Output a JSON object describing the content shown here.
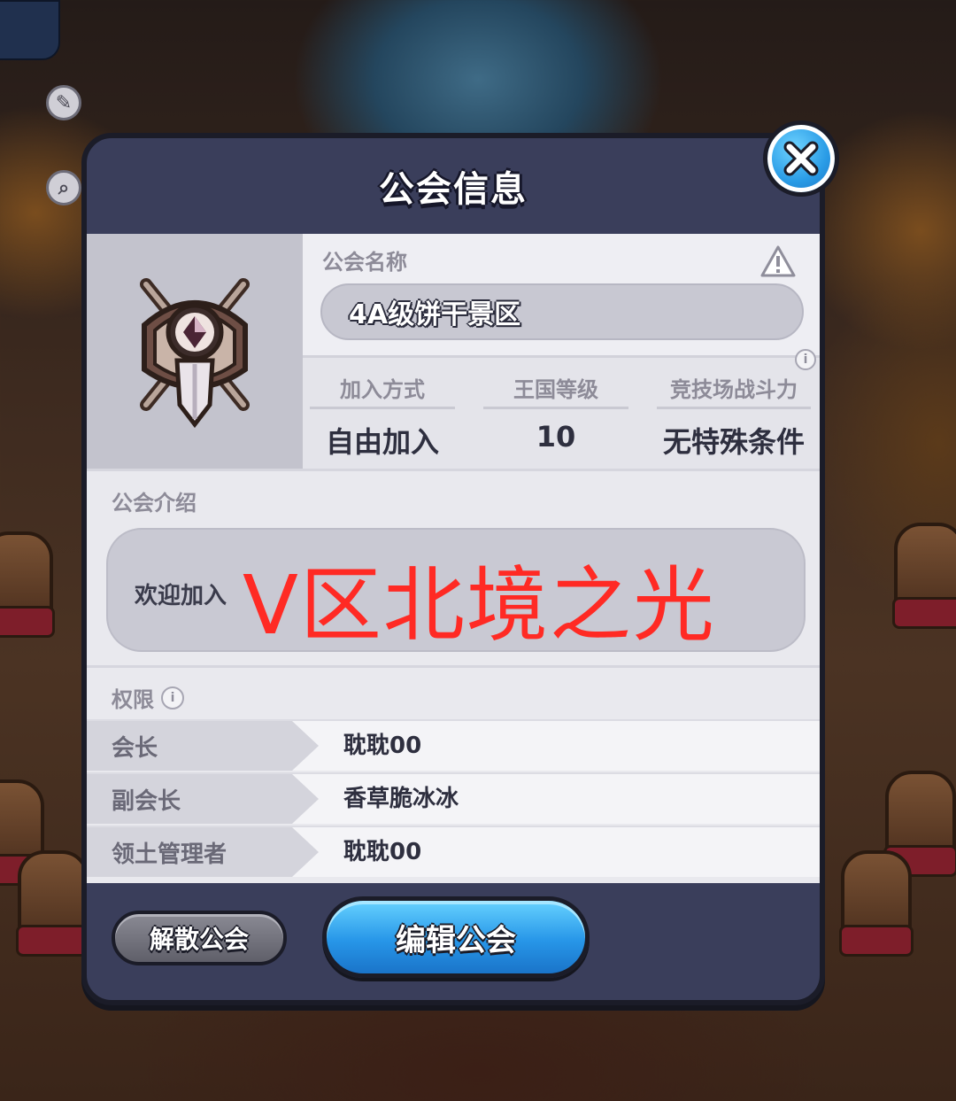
{
  "dialog": {
    "title": "公会信息",
    "close_icon": "close-icon"
  },
  "guild": {
    "name_label": "公会名称",
    "name": "4A级饼干景区",
    "stats": [
      {
        "label": "加入方式",
        "value": "自由加入"
      },
      {
        "label": "王国等级",
        "value": "10"
      },
      {
        "label": "竞技场战斗力",
        "value": "无特殊条件"
      }
    ]
  },
  "intro": {
    "label": "公会介绍",
    "text": "欢迎加入",
    "overlay": "V区北境之光"
  },
  "permissions": {
    "label": "权限",
    "rows": [
      {
        "role": "会长",
        "name": "耽耽00"
      },
      {
        "role": "副会长",
        "name": "香草脆冰冰"
      },
      {
        "role": "领土管理者",
        "name": "耽耽00"
      }
    ]
  },
  "buttons": {
    "disband": "解散公会",
    "edit": "编辑公会"
  },
  "colors": {
    "dialog_bg": "#3a3e5b",
    "accent_blue": "#2796e8",
    "overlay_red": "#ff2a24"
  }
}
